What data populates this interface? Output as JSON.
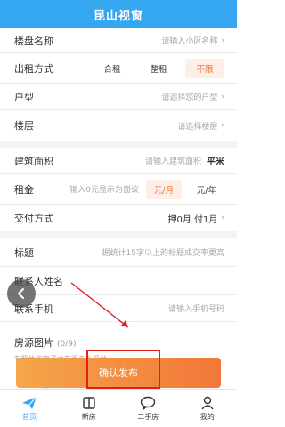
{
  "header": {
    "title": "昆山视窗"
  },
  "form": {
    "estate": {
      "label": "楼盘名称",
      "placeholder": "请输入小区名称"
    },
    "rent_type": {
      "label": "出租方式",
      "options": [
        "合租",
        "整租",
        "不限"
      ],
      "selected": "不限"
    },
    "layout": {
      "label": "户型",
      "placeholder": "请选择您的户型"
    },
    "floor": {
      "label": "楼层",
      "placeholder": "请选择楼层"
    },
    "area": {
      "label": "建筑面积",
      "placeholder": "请输入建筑面积",
      "unit": "平米"
    },
    "rent": {
      "label": "租金",
      "placeholder": "输入0元显示为面议",
      "units": [
        "元/月",
        "元/年"
      ],
      "selected": "元/月"
    },
    "payment": {
      "label": "交付方式",
      "value": "押0月 付1月"
    },
    "title": {
      "label": "标题",
      "placeholder": "据统计15字以上的标题成交率更高"
    },
    "contact_name": {
      "label": "联系人姓名"
    },
    "contact_phone": {
      "label": "联系手机",
      "placeholder": "请输入手机号码"
    },
    "photos": {
      "label": "房源图片",
      "count": "(0/9)",
      "tip": "有照片的房子才有更多人采纳"
    }
  },
  "submit_label": "确认发布",
  "tabs": [
    {
      "label": "首页",
      "icon": "paper-plane-icon",
      "active": true
    },
    {
      "label": "新房",
      "icon": "book-icon",
      "active": false
    },
    {
      "label": "二手房",
      "icon": "chat-icon",
      "active": false
    },
    {
      "label": "我的",
      "icon": "person-icon",
      "active": false
    }
  ],
  "colors": {
    "accent": "#35a6f0",
    "orange": "#f0743a",
    "annotation": "#e02020"
  }
}
